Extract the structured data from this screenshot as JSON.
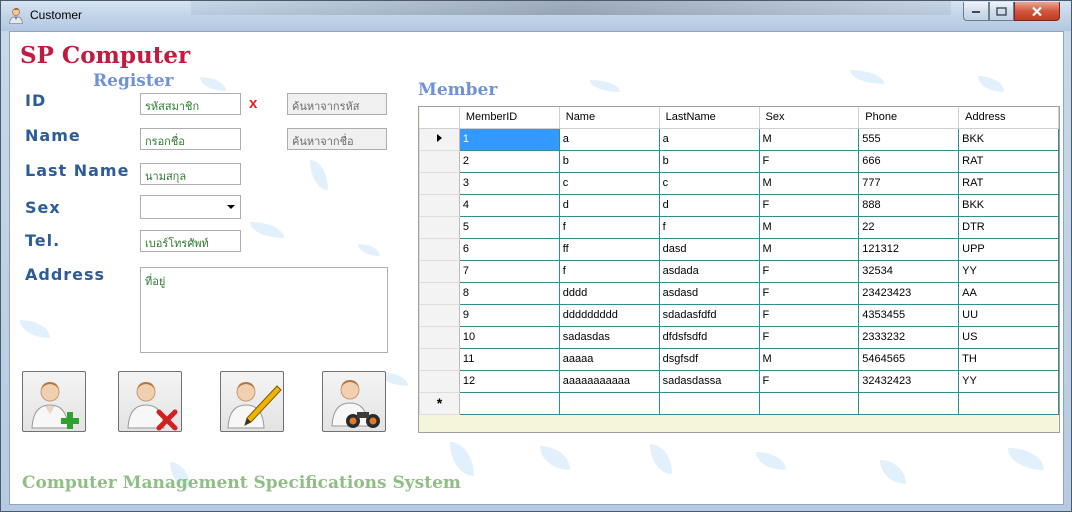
{
  "window": {
    "title": "Customer"
  },
  "form": {
    "brand": "SP Computer",
    "register_title": "Register",
    "labels": {
      "id": "ID",
      "name": "Name",
      "last_name": "Last Name",
      "sex": "Sex",
      "tel": "Tel.",
      "address": "Address"
    },
    "fields": {
      "id_placeholder": "รหัสสมาชิก",
      "name_placeholder": "กรอกชื่อ",
      "last_name_placeholder": "นามสกุล",
      "sex_value": "",
      "tel_placeholder": "เบอร์โทรศัพท์",
      "address_placeholder": "ที่อยู่"
    },
    "clear_symbol": "x",
    "search": {
      "by_id": "ค้นหาจากรหัส",
      "by_name": "ค้นหาจากชื่อ"
    },
    "footer": "Computer Management Specifications System"
  },
  "actions": [
    {
      "icon": "add-user-icon"
    },
    {
      "icon": "delete-user-icon"
    },
    {
      "icon": "edit-user-icon"
    },
    {
      "icon": "search-user-icon"
    }
  ],
  "grid": {
    "title": "Member",
    "columns": [
      "MemberID",
      "Name",
      "LastName",
      "Sex",
      "Phone",
      "Address"
    ],
    "rows": [
      [
        "1",
        "a",
        "a",
        "M",
        "555",
        "BKK"
      ],
      [
        "2",
        "b",
        "b",
        "F",
        "666",
        "RAT"
      ],
      [
        "3",
        "c",
        "c",
        "M",
        "777",
        "RAT"
      ],
      [
        "4",
        "d",
        "d",
        "F",
        "888",
        "BKK"
      ],
      [
        "5",
        "f",
        "f",
        "M",
        "22",
        "DTR"
      ],
      [
        "6",
        "ff",
        "dasd",
        "M",
        "121312",
        "UPP"
      ],
      [
        "7",
        "f",
        "asdada",
        "F",
        "32534",
        "YY"
      ],
      [
        "8",
        "dddd",
        "asdasd",
        "F",
        "23423423",
        "AA"
      ],
      [
        "9",
        "ddddddddd",
        "sdadasfdfd",
        "F",
        "4353455",
        "UU"
      ],
      [
        "10",
        "sadasdas",
        "dfdsfsdfd",
        "F",
        "2333232",
        "US"
      ],
      [
        "11",
        "aaaaa",
        "dsgfsdf",
        "M",
        "5464565",
        "TH"
      ],
      [
        "12",
        "aaaaaaaaaaa",
        "sadasdassa",
        "F",
        "32432423",
        "YY"
      ]
    ],
    "selected_row": 0,
    "new_row_marker": "*"
  },
  "colors": {
    "brand": "#c41a40",
    "section_title": "#6f92d6",
    "label": "#2d5c96",
    "footer": "#8fbf84",
    "selection": "#3399ff",
    "grid_line": "#2f8f8f"
  }
}
